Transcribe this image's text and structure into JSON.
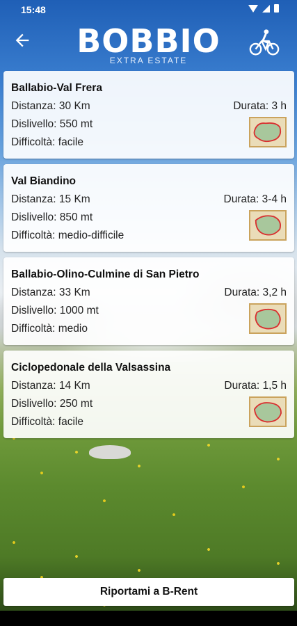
{
  "status_bar": {
    "time": "15:48"
  },
  "header": {
    "title": "BOBBIO",
    "subtitle": "EXTRA ESTATE"
  },
  "routes": [
    {
      "name": "Ballabio-Val Frera",
      "distance": "Distanza: 30 Km",
      "duration": "Durata: 3 h",
      "elevation": "Dislivello: 550 mt",
      "difficulty": "Difficoltà: facile"
    },
    {
      "name": "Val Biandino",
      "distance": "Distanza: 15 Km",
      "duration": "Durata: 3-4 h",
      "elevation": "Dislivello: 850 mt",
      "difficulty": "Difficoltà: medio-difficile"
    },
    {
      "name": "Ballabio-Olino-Culmine di San Pietro",
      "distance": "Distanza: 33 Km",
      "duration": "Durata: 3,2 h",
      "elevation": "Dislivello: 1000 mt",
      "difficulty": "Difficoltà: medio"
    },
    {
      "name": "Ciclopedonale della Valsassina",
      "distance": "Distanza: 14 Km",
      "duration": "Durata: 1,5 h",
      "elevation": "Dislivello: 250 mt",
      "difficulty": "Difficoltà: facile"
    }
  ],
  "footer": {
    "button_label": "Riportami a B-Rent"
  },
  "icons": {
    "back": "arrow-left-icon",
    "bike": "bicycle-icon",
    "map": "route-map-icon"
  },
  "colors": {
    "header_blue": "#1f5fb6",
    "route_red": "#d93030",
    "map_border": "#caa35d"
  }
}
